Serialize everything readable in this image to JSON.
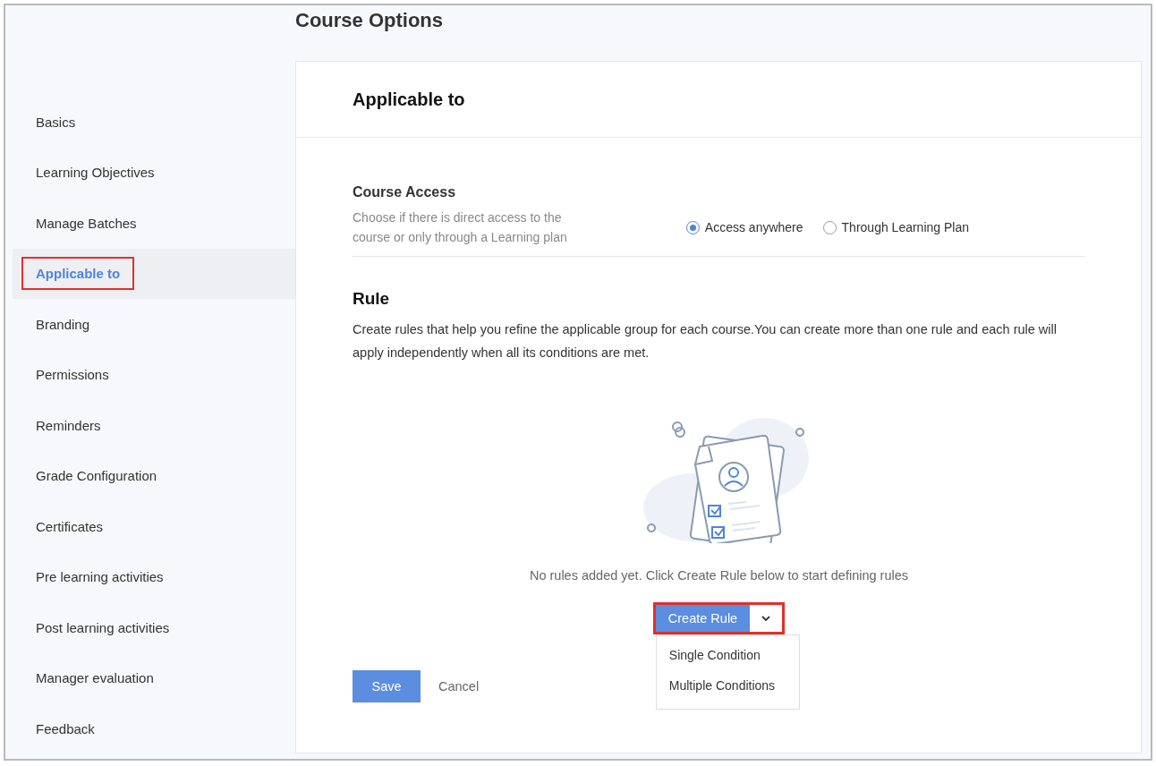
{
  "page_title": "Course Options",
  "sidebar": {
    "items": [
      {
        "label": "Basics",
        "selected": false,
        "highlighted": false
      },
      {
        "label": "Learning Objectives",
        "selected": false,
        "highlighted": false
      },
      {
        "label": "Manage Batches",
        "selected": false,
        "highlighted": false
      },
      {
        "label": "Applicable to",
        "selected": true,
        "highlighted": true
      },
      {
        "label": "Branding",
        "selected": false,
        "highlighted": false
      },
      {
        "label": "Permissions",
        "selected": false,
        "highlighted": false
      },
      {
        "label": "Reminders",
        "selected": false,
        "highlighted": false
      },
      {
        "label": "Grade Configuration",
        "selected": false,
        "highlighted": false
      },
      {
        "label": "Certificates",
        "selected": false,
        "highlighted": false
      },
      {
        "label": "Pre learning activities",
        "selected": false,
        "highlighted": false
      },
      {
        "label": "Post learning activities",
        "selected": false,
        "highlighted": false
      },
      {
        "label": "Manager evaluation",
        "selected": false,
        "highlighted": false
      },
      {
        "label": "Feedback",
        "selected": false,
        "highlighted": false
      }
    ]
  },
  "panel": {
    "title": "Applicable to",
    "course_access": {
      "heading": "Course Access",
      "description": "Choose if there is direct access to the course or only through a Learning plan",
      "options": [
        {
          "label": "Access anywhere",
          "selected": true
        },
        {
          "label": "Through Learning Plan",
          "selected": false
        }
      ]
    },
    "rule": {
      "heading": "Rule",
      "description": "Create rules that help you refine the applicable group for each course.You can create more than one rule and each rule will apply independently when all its conditions are met.",
      "empty_message": "No rules added yet. Click Create Rule below to start defining rules",
      "create_button": {
        "label": "Create Rule",
        "highlighted": true,
        "expanded": true
      },
      "menu": [
        "Single Condition",
        "Multiple Conditions"
      ]
    },
    "save": "Save",
    "cancel": "Cancel"
  }
}
